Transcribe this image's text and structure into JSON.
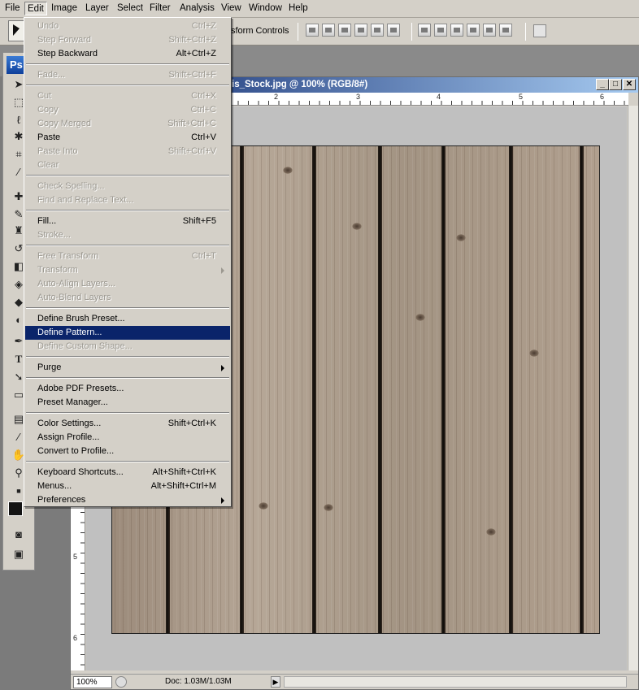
{
  "menubar": {
    "items": [
      "File",
      "Edit",
      "Image",
      "Layer",
      "Select",
      "Filter",
      "Analysis",
      "View",
      "Window",
      "Help"
    ]
  },
  "options_bar": {
    "transform_label": "sform Controls"
  },
  "toolbox": {
    "logo": "Ps"
  },
  "document": {
    "title": "is_Stock.jpg @ 100% (RGB/8#)",
    "ruler_top": [
      "2",
      "3",
      "4",
      "5",
      "6"
    ],
    "ruler_left": [
      "5",
      "6"
    ],
    "zoom": "100%",
    "doc_size": "Doc: 1.03M/1.03M"
  },
  "edit_menu": {
    "items": [
      {
        "label": "Undo",
        "shortcut": "Ctrl+Z",
        "enabled": false
      },
      {
        "label": "Step Forward",
        "shortcut": "Shift+Ctrl+Z",
        "enabled": false
      },
      {
        "label": "Step Backward",
        "shortcut": "Alt+Ctrl+Z",
        "enabled": true
      },
      {
        "label": "Fade...",
        "shortcut": "Shift+Ctrl+F",
        "enabled": false
      },
      {
        "label": "Cut",
        "shortcut": "Ctrl+X",
        "enabled": false
      },
      {
        "label": "Copy",
        "shortcut": "Ctrl+C",
        "enabled": false
      },
      {
        "label": "Copy Merged",
        "shortcut": "Shift+Ctrl+C",
        "enabled": false
      },
      {
        "label": "Paste",
        "shortcut": "Ctrl+V",
        "enabled": true
      },
      {
        "label": "Paste Into",
        "shortcut": "Shift+Ctrl+V",
        "enabled": false
      },
      {
        "label": "Clear",
        "shortcut": "",
        "enabled": false
      },
      {
        "label": "Check Spelling...",
        "shortcut": "",
        "enabled": false
      },
      {
        "label": "Find and Replace Text...",
        "shortcut": "",
        "enabled": false
      },
      {
        "label": "Fill...",
        "shortcut": "Shift+F5",
        "enabled": true
      },
      {
        "label": "Stroke...",
        "shortcut": "",
        "enabled": false
      },
      {
        "label": "Free Transform",
        "shortcut": "Ctrl+T",
        "enabled": false
      },
      {
        "label": "Transform",
        "shortcut": "",
        "enabled": false
      },
      {
        "label": "Auto-Align Layers...",
        "shortcut": "",
        "enabled": false
      },
      {
        "label": "Auto-Blend Layers",
        "shortcut": "",
        "enabled": false
      },
      {
        "label": "Define Brush Preset...",
        "shortcut": "",
        "enabled": true
      },
      {
        "label": "Define Pattern...",
        "shortcut": "",
        "enabled": true
      },
      {
        "label": "Define Custom Shape...",
        "shortcut": "",
        "enabled": false
      },
      {
        "label": "Purge",
        "shortcut": "",
        "enabled": true
      },
      {
        "label": "Adobe PDF Presets...",
        "shortcut": "",
        "enabled": true
      },
      {
        "label": "Preset Manager...",
        "shortcut": "",
        "enabled": true
      },
      {
        "label": "Color Settings...",
        "shortcut": "Shift+Ctrl+K",
        "enabled": true
      },
      {
        "label": "Assign Profile...",
        "shortcut": "",
        "enabled": true
      },
      {
        "label": "Convert to Profile...",
        "shortcut": "",
        "enabled": true
      },
      {
        "label": "Keyboard Shortcuts...",
        "shortcut": "Alt+Shift+Ctrl+K",
        "enabled": true
      },
      {
        "label": "Menus...",
        "shortcut": "Alt+Shift+Ctrl+M",
        "enabled": true
      },
      {
        "label": "Preferences",
        "shortcut": "",
        "enabled": true
      }
    ],
    "highlighted": "Define Pattern..."
  },
  "colors": {
    "highlight": "#0a246a",
    "menu_bg": "#d4d0c8"
  }
}
